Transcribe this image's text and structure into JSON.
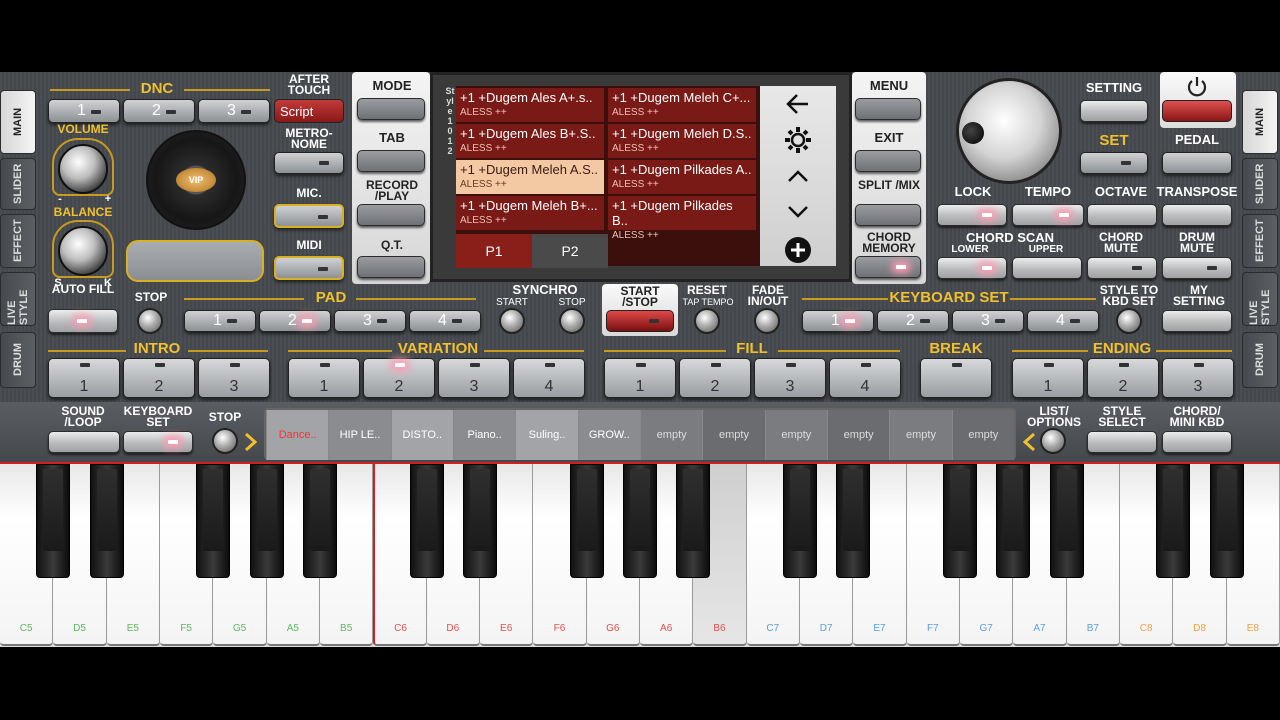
{
  "side_tabs": {
    "left": [
      "MAIN",
      "SLIDER",
      "EFFECT",
      "LIVE STYLE",
      "DRUM"
    ],
    "right": [
      "MAIN",
      "SLIDER",
      "EFFECT",
      "LIVE STYLE",
      "DRUM"
    ]
  },
  "dnc": {
    "label": "DNC",
    "buttons": [
      "1",
      "2",
      "3",
      "Script"
    ],
    "after_touch": "AFTER TOUCH"
  },
  "volume_label": "VOLUME",
  "balance_label": "BALANCE",
  "balance_marks": {
    "minus": "-",
    "plus": "+",
    "s": "S",
    "k": "K"
  },
  "vip_label": "VIP",
  "metronome": "METRO-NOME",
  "mic": "MIC.",
  "midi": "MIDI",
  "left_menu": {
    "mode": "MODE",
    "tab": "TAB",
    "record": "RECORD /PLAY",
    "qt": "Q.T."
  },
  "right_menu": {
    "menu": "MENU",
    "exit": "EXIT",
    "split": "SPLIT /MIX",
    "chord_memory": "CHORD MEMORY"
  },
  "screen": {
    "side_label": "Style 1 0 1 2",
    "styles": [
      {
        "name": "+1 +Dugem Ales A+.s..",
        "sub": "ALESS ++",
        "selected": false
      },
      {
        "name": "+1 +Dugem Meleh C+...",
        "sub": "ALESS ++",
        "selected": false
      },
      {
        "name": "+1 +Dugem Ales B+.S..",
        "sub": "ALESS ++",
        "selected": false
      },
      {
        "name": "+1 +Dugem Meleh D.S..",
        "sub": "ALESS ++",
        "selected": false
      },
      {
        "name": "+1 +Dugem Meleh A.S..",
        "sub": "ALESS ++",
        "selected": true
      },
      {
        "name": "+1 +Dugem Pilkades A..",
        "sub": "ALESS ++",
        "selected": false
      },
      {
        "name": "+1 +Dugem Meleh B+...",
        "sub": "ALESS ++",
        "selected": false
      },
      {
        "name": "+1 +Dugem Pilkades B..",
        "sub": "ALESS ++",
        "selected": false
      }
    ],
    "pages": [
      "P1",
      "P2"
    ],
    "icons": [
      "back-arrow-icon",
      "gear-icon",
      "chevron-up-icon",
      "chevron-down-icon",
      "plus-circle-icon"
    ]
  },
  "top_right": {
    "setting": "SETTING",
    "set": "SET",
    "pedal": "PEDAL",
    "lock": "LOCK",
    "tempo": "TEMPO",
    "octave": "OCTAVE",
    "transpose": "TRANSPOSE",
    "chord_scan": "CHORD SCAN",
    "lower": "LOWER",
    "upper": "UPPER",
    "chord_mute": "CHORD MUTE",
    "drum_mute": "DRUM MUTE"
  },
  "row3": {
    "auto_fill": "AUTO FILL",
    "stop": "STOP",
    "pad": "PAD",
    "pad_buttons": [
      "1",
      "2",
      "3",
      "4"
    ],
    "synchro": "SYNCHRO",
    "synchro_start": "START",
    "synchro_stop": "STOP",
    "start_stop": "START /STOP",
    "reset": "RESET",
    "tap_tempo": "TAP TEMPO",
    "fade": "FADE IN/OUT",
    "keyboard_set": "KEYBOARD SET",
    "kbd_buttons": [
      "1",
      "2",
      "3",
      "4"
    ],
    "style_to_kbd": "STYLE TO KBD SET",
    "my_setting": "MY SETTING"
  },
  "sections": {
    "intro": {
      "label": "INTRO",
      "buttons": [
        "1",
        "2",
        "3"
      ]
    },
    "variation": {
      "label": "VARIATION",
      "buttons": [
        "1",
        "2",
        "3",
        "4"
      ]
    },
    "fill": {
      "label": "FILL",
      "buttons": [
        "1",
        "2",
        "3",
        "4"
      ]
    },
    "break": {
      "label": "BREAK"
    },
    "ending": {
      "label": "ENDING",
      "buttons": [
        "1",
        "2",
        "3"
      ]
    }
  },
  "row5": {
    "sound_loop": "SOUND /LOOP",
    "keyboard_set": "KEYBOARD SET",
    "stop": "STOP",
    "list_options": "LIST/ OPTIONS",
    "style_select": "STYLE SELECT",
    "chord_mini": "CHORD/ MINI KBD"
  },
  "registrations": [
    "Dance..",
    "HIP LE..",
    "DISTO..",
    "Piano..",
    "Suling..",
    "GROW..",
    "empty",
    "empty",
    "empty",
    "empty",
    "empty",
    "empty"
  ],
  "keys": [
    "C5",
    "D5",
    "E5",
    "F5",
    "G5",
    "A5",
    "B5",
    "C6",
    "D6",
    "E6",
    "F6",
    "G6",
    "A6",
    "B6",
    "C7",
    "D7",
    "E7",
    "F7",
    "G7",
    "A7",
    "B7",
    "C8",
    "D8",
    "E8"
  ],
  "colors": {
    "accent_gold": "#f0c030",
    "selected_style": "#f3c9a4",
    "style_bg": "#7a1a16",
    "key_green": "#5cb85c",
    "key_red": "#e05050",
    "key_blue": "#5aa0e0",
    "key_orange": "#f0a040"
  }
}
